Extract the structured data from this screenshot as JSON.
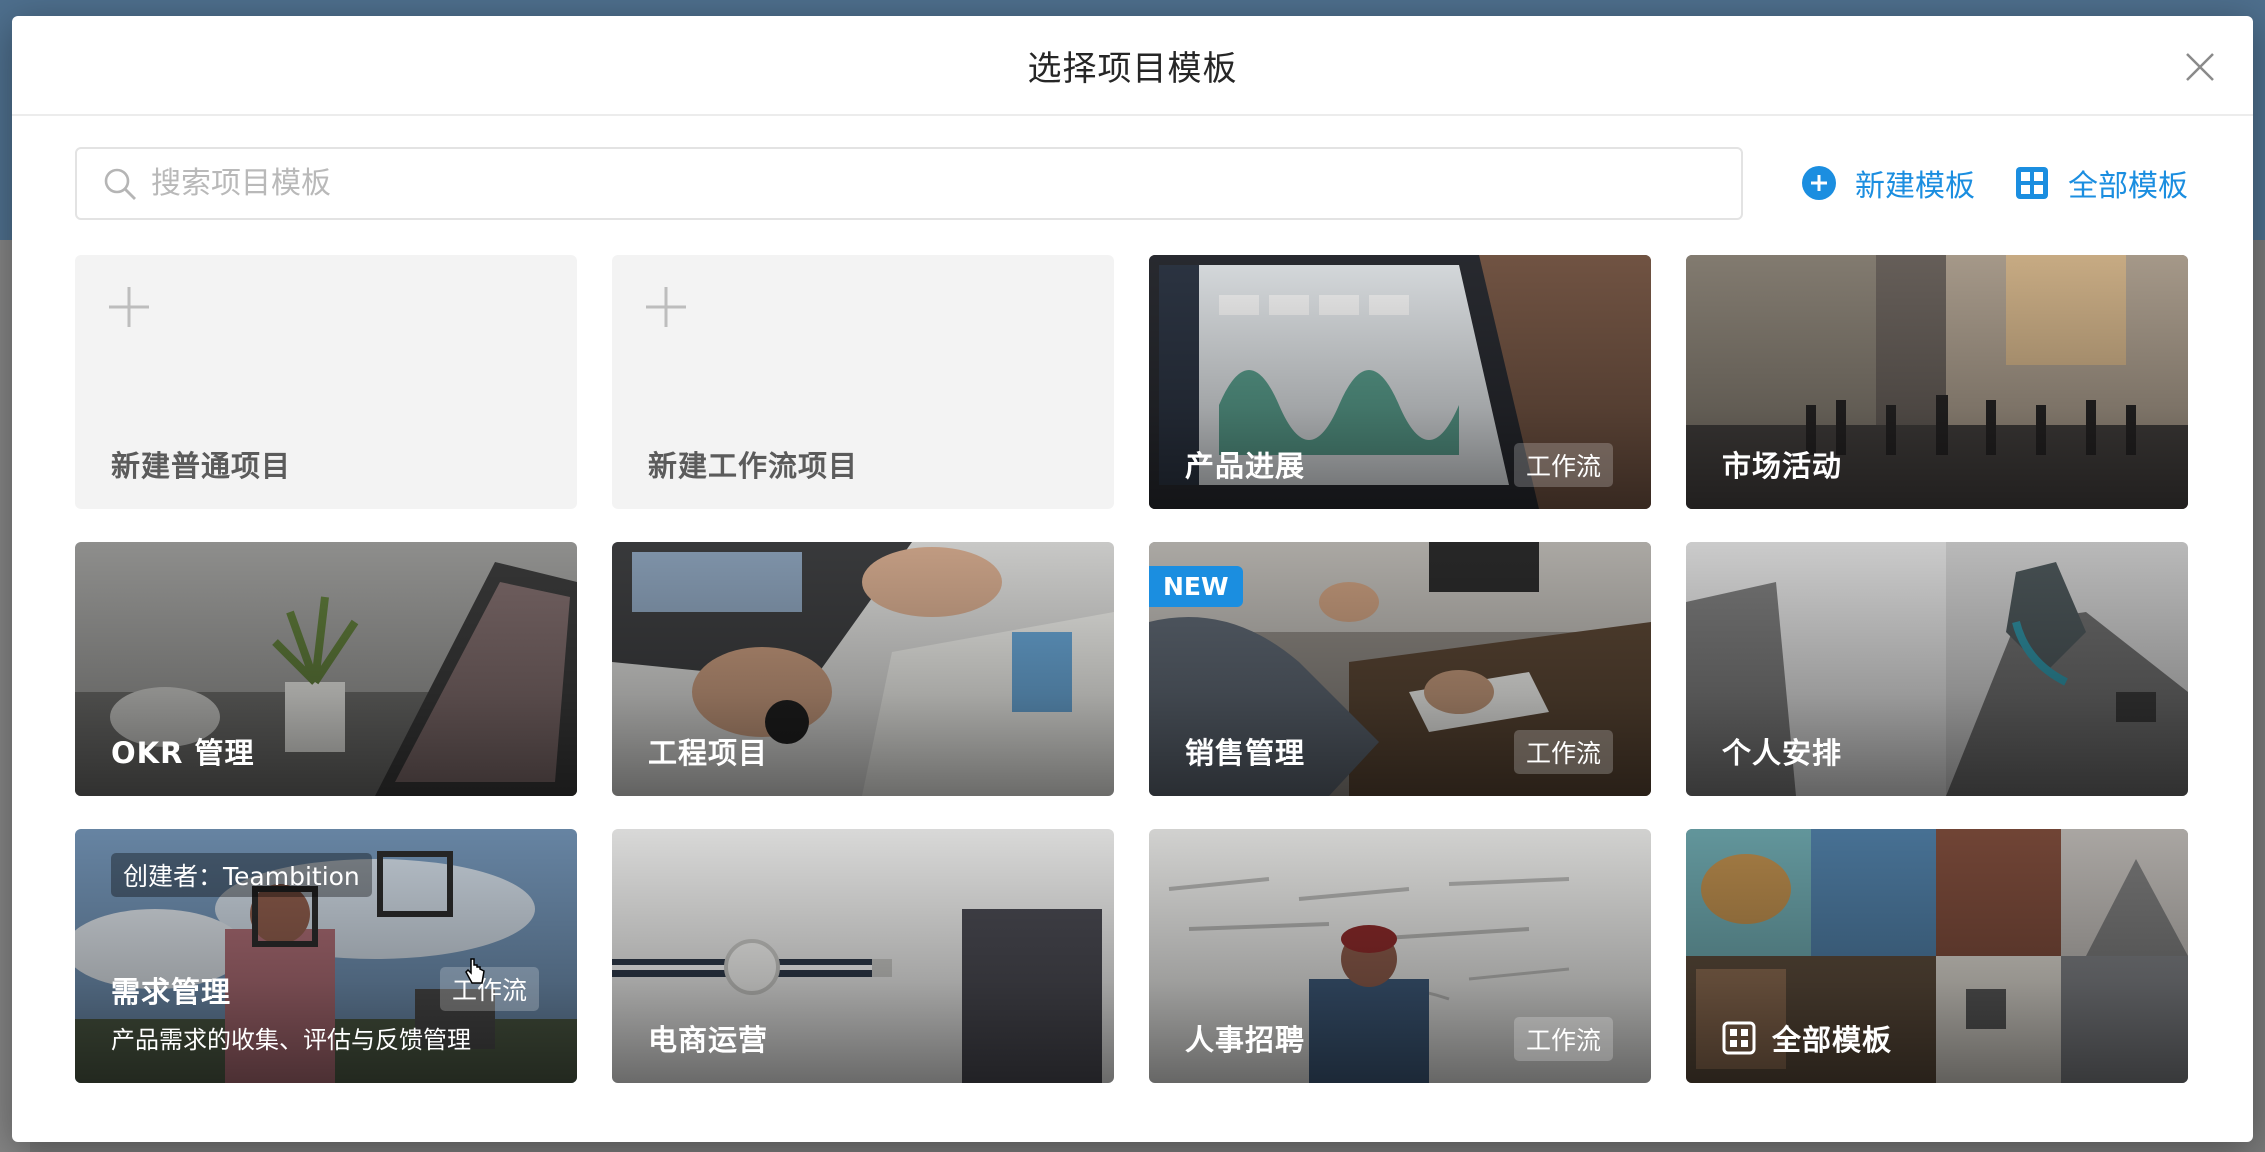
{
  "modal": {
    "title": "选择项目模板"
  },
  "search": {
    "placeholder": "搜索项目模板"
  },
  "toolbar": {
    "new_template": "新建模板",
    "all_templates": "全部模板"
  },
  "colors": {
    "accent": "#1b8ee0",
    "blank_card_bg": "#f3f3f3"
  },
  "cards": [
    {
      "title": "新建普通项目",
      "icon": "plus-icon"
    },
    {
      "title": "新建工作流项目",
      "icon": "plus-icon"
    },
    {
      "title": "产品进展",
      "badge": "工作流"
    },
    {
      "title": "市场活动"
    },
    {
      "title": "OKR 管理"
    },
    {
      "title": "工程项目"
    },
    {
      "title": "销售管理",
      "badge": "工作流",
      "tag": "NEW"
    },
    {
      "title": "个人安排"
    },
    {
      "title": "需求管理",
      "badge": "工作流",
      "creator": "创建者：Teambition",
      "description": "产品需求的收集、评估与反馈管理"
    },
    {
      "title": "电商运营"
    },
    {
      "title": "人事招聘",
      "badge": "工作流"
    },
    {
      "title": "全部模板",
      "icon": "grid-icon"
    }
  ]
}
